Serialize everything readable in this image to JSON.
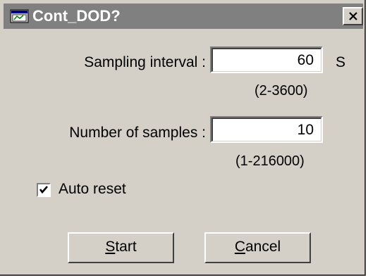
{
  "window": {
    "title": "Cont_DOD?",
    "close_label": "Close"
  },
  "form": {
    "sampling_interval": {
      "label": "Sampling interval :",
      "value": "60",
      "unit": "S",
      "range": "(2-3600)"
    },
    "number_of_samples": {
      "label": "Number of samples :",
      "value": "10",
      "range": "(1-216000)"
    },
    "auto_reset": {
      "label": "Auto reset",
      "checked": true
    }
  },
  "buttons": {
    "start": {
      "mnemonic": "S",
      "rest": "tart"
    },
    "cancel": {
      "mnemonic": "C",
      "rest": "ancel"
    }
  },
  "icons": {
    "title_icon": "app-window-icon",
    "close_icon": "close-x-icon",
    "check_icon": "checkmark-icon"
  }
}
